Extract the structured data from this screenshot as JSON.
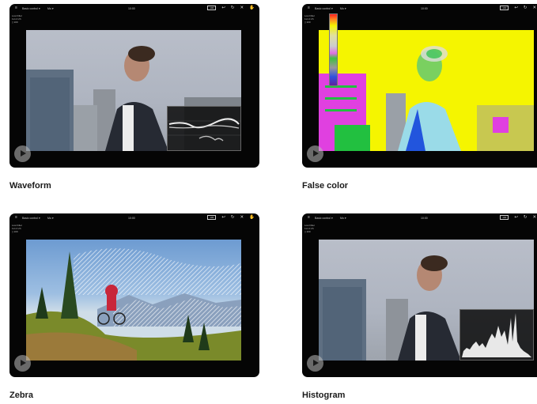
{
  "panels": [
    {
      "id": "waveform",
      "caption": "Waveform",
      "menu_label": "Basic control ▾",
      "secondary": "Mo ▾",
      "timecode": "10:00",
      "battery": "100",
      "icons": [
        "menu-icon",
        "return-icon",
        "refresh-icon",
        "close-icon",
        "hand-icon"
      ],
      "side_lines": [
        "Low Filter",
        "1x1.0 2h",
        "▯ 100",
        "   min"
      ]
    },
    {
      "id": "false-color",
      "caption": "False color",
      "menu_label": "Basic control ▾",
      "secondary": "Mo ▾",
      "timecode": "10:00",
      "battery": "100",
      "icons": [
        "menu-icon",
        "return-icon",
        "refresh-icon",
        "close-icon",
        "hand-icon"
      ],
      "side_lines": [
        "Low Filter",
        "1x1.0 2h",
        "▯ 100",
        "   min"
      ]
    },
    {
      "id": "zebra",
      "caption": "Zebra",
      "menu_label": "Basic control ▾",
      "secondary": "Mo ▾",
      "timecode": "10:00",
      "battery": "100",
      "icons": [
        "menu-icon",
        "return-icon",
        "refresh-icon",
        "close-icon",
        "hand-icon"
      ],
      "side_lines": [
        "Low Filter",
        "1x1.0 2h",
        "▯ 100",
        "   min"
      ]
    },
    {
      "id": "histogram",
      "caption": "Histogram",
      "menu_label": "Basic control ▾",
      "secondary": "Mo ▾",
      "timecode": "10:00",
      "battery": "100",
      "icons": [
        "menu-icon",
        "return-icon",
        "refresh-icon",
        "close-icon",
        "hand-icon"
      ],
      "side_lines": [
        "Low Filter",
        "1x1.0 2h",
        "▯ 100",
        "   min"
      ]
    }
  ],
  "colors": {
    "device": "#050505",
    "caption": "#1a1a1a",
    "false_color_yellow": "#f5f500",
    "false_color_magenta": "#e040e0",
    "false_color_green": "#22c040"
  }
}
